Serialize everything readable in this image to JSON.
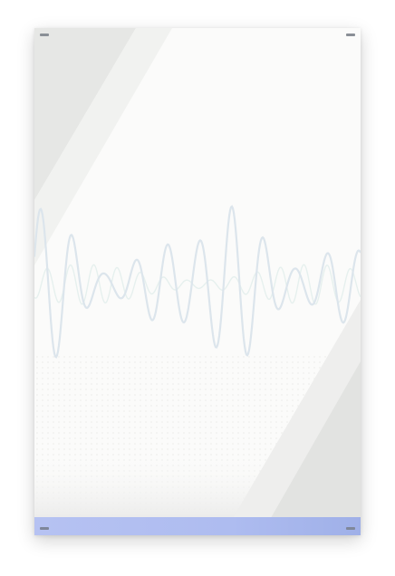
{
  "palette": {
    "paper": "#fbfbfa",
    "band_light": "#f0f1ef",
    "band_mid": "#e7e8e6",
    "band_dark": "#dfe0de",
    "wave_primary": "#dde6ec",
    "wave_secondary": "#e8f1ef",
    "footer_strip": "#aebcf0",
    "corner_mark": "#8a8f96"
  },
  "icons": {
    "corner_marks": "crop-mark-icon"
  }
}
